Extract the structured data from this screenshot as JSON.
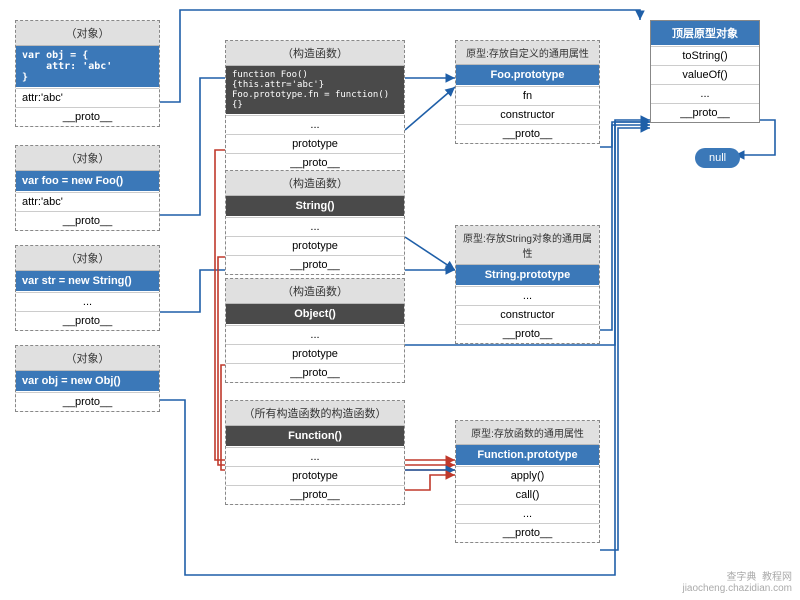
{
  "labels": {
    "object": "（对象）",
    "constructor": "（构造函数）",
    "all_constructors": "（所有构造函数的构造函数）",
    "top_proto": "顶层原型对象",
    "proto_custom": "原型:存放自定义的通用属性",
    "proto_string": "原型:存放String对象的通用属性",
    "proto_function": "原型:存放函数的通用属性"
  },
  "obj1": {
    "title": "var obj = {\n    attr: 'abc'\n}",
    "r1": "attr:'abc'",
    "r2": "__proto__"
  },
  "foo": {
    "title": "var foo = new Foo()",
    "r1": "attr:'abc'",
    "r2": "__proto__"
  },
  "str": {
    "title": "var str = new String()",
    "r1": "...",
    "r2": "__proto__"
  },
  "obj2": {
    "title": "var obj = new Obj()",
    "r1": "__proto__"
  },
  "cFoo": {
    "t1": "function Foo(){this.attr='abc'}",
    "t2": "Foo.prototype.fn = function(){}",
    "r1": "...",
    "r2": "prototype",
    "r3": "__proto__"
  },
  "cString": {
    "t": "String()",
    "r1": "...",
    "r2": "prototype",
    "r3": "__proto__"
  },
  "cObject": {
    "t": "Object()",
    "r1": "...",
    "r2": "prototype",
    "r3": "__proto__"
  },
  "cFunction": {
    "t": "Function()",
    "r1": "...",
    "r2": "prototype",
    "r3": "__proto__"
  },
  "pFoo": {
    "t": "Foo.prototype",
    "r1": "fn",
    "r2": "constructor",
    "r3": "__proto__"
  },
  "pString": {
    "t": "String.prototype",
    "r1": "...",
    "r2": "constructor",
    "r3": "__proto__"
  },
  "pFunction": {
    "t": "Function.prototype",
    "r1": "apply()",
    "r2": "call()",
    "r3": "...",
    "r4": "__proto__"
  },
  "top": {
    "r1": "toString()",
    "r2": "valueOf()",
    "r3": "...",
    "r4": "__proto__"
  },
  "nullLabel": "null",
  "watermark": "查字典  教程网\njiaocheng.chazidian.com"
}
